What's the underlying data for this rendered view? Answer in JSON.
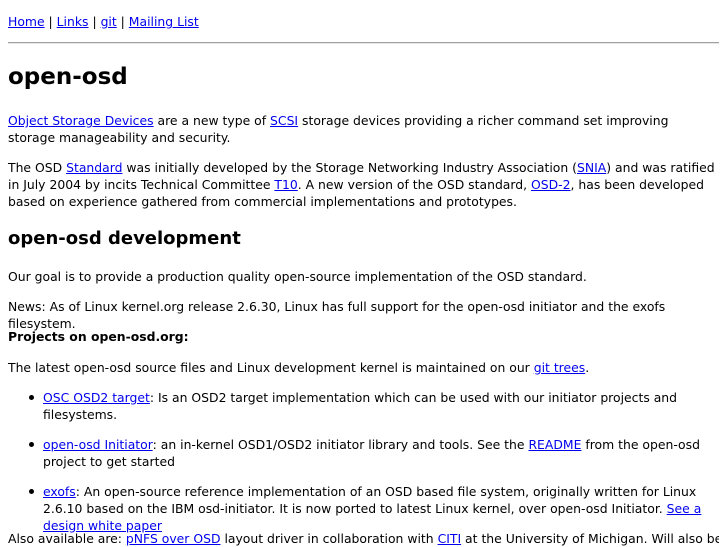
{
  "nav": {
    "home": "Home",
    "sep": " | ",
    "links": "Links",
    "git": "git",
    "mailing": "Mailing List"
  },
  "title": "open-osd",
  "intro": {
    "osd_link": "Object Storage Devices",
    "t1": " are a new type of ",
    "scsi_link": "SCSI",
    "t2": " storage devices providing a richer command set improving storage manageability and security."
  },
  "history": {
    "t1": "The OSD ",
    "standard_link": "Standard",
    "t2": " was initially developed by the Storage Networking Industry Association (",
    "snia_link": "SNIA",
    "t3": ") and was ratified in July 2004 by incits Technical Committee ",
    "t10_link": "T10",
    "t4": ". A new version of the OSD standard, ",
    "osd2_link": "OSD-2",
    "t5": ", has been developed based on experience gathered from commercial implementations and prototypes."
  },
  "dev_heading": "open-osd development",
  "goal": "Our goal is to provide a production quality open-source implementation of the OSD standard.",
  "news": "News: As of Linux kernel.org release 2.6.30, Linux has full support for the open-osd initiator and the exofs filesystem.",
  "projects_heading": "Projects on open-osd.org:",
  "latest": {
    "t1": "The latest open-osd source files and Linux development kernel is maintained on our ",
    "git_link": "git trees",
    "t2": "."
  },
  "items": [
    {
      "link": "OSC OSD2 target",
      "t1": ": Is an OSD2 target implementation which can be used with our initiator projects and filesystems."
    },
    {
      "link": "open-osd Initiator",
      "t1": ": an in-kernel OSD1/OSD2 initiator library and tools. See the ",
      "link2": "README",
      "t2": " from the open-osd project to get started"
    },
    {
      "link": "exofs",
      "t1": ": An open-source reference implementation of an OSD based file system, originally written for Linux 2.6.10 based on the IBM osd-initiator. It is now ported to latest Linux kernel, over open-osd Initiator. ",
      "link2": "See a design white paper"
    }
  ],
  "also": {
    "t1": "Also available are: ",
    "pnfs_link": "pNFS over OSD",
    "t2": " layout driver in collaboration with ",
    "citi_link": "CITI",
    "t3": " at the University of Michigan. Will also be using"
  },
  "colors": {
    "link": "#0000ee",
    "text": "#000000",
    "rule": "#a0a0a0"
  }
}
